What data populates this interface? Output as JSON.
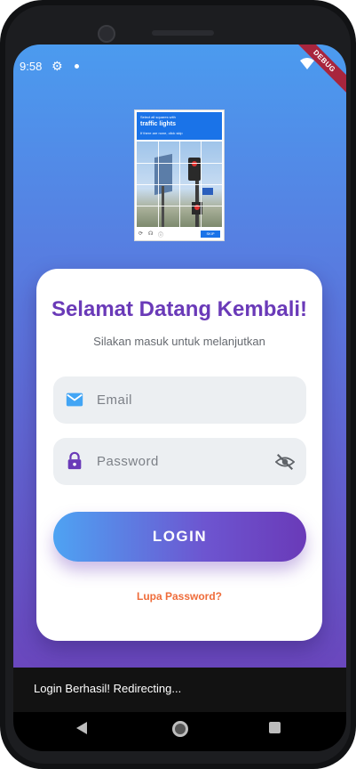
{
  "status_bar": {
    "time": "9:58",
    "debug_label": "DEBUG"
  },
  "captcha": {
    "instruction": "Select all squares with",
    "target": "traffic lights",
    "hint": "If there are none, click skip",
    "verify_label": "SKIP"
  },
  "card": {
    "title": "Selamat Datang Kembali!",
    "subtitle": "Silakan masuk untuk melanjutkan",
    "email_placeholder": "Email",
    "password_placeholder": "Password",
    "login_label": "LOGIN",
    "forgot_label": "Lupa Password?"
  },
  "snackbar": {
    "message": "Login Berhasil! Redirecting..."
  },
  "colors": {
    "accent_purple": "#6a3ab8",
    "accent_blue": "#4ea3f3",
    "forgot_orange": "#ef6c3a",
    "email_icon_blue": "#42a5f5",
    "lock_icon_purple": "#6a3ab8"
  },
  "icons": [
    "settings-gear-icon",
    "wifi-icon",
    "email-icon",
    "lock-icon",
    "visibility-off-icon",
    "back-icon",
    "home-icon",
    "recents-icon"
  ]
}
